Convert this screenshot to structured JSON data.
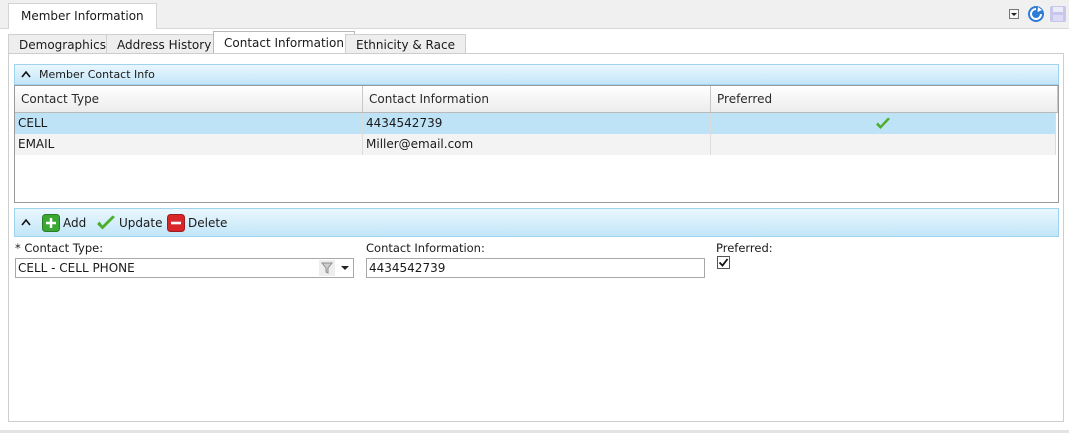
{
  "window": {
    "tab_title": "Member Information"
  },
  "tabs": [
    {
      "label": "Demographics"
    },
    {
      "label": "Address History"
    },
    {
      "label": "Contact Information"
    },
    {
      "label": "Ethnicity & Race"
    }
  ],
  "active_tab_index": 2,
  "section": {
    "title": "Member Contact Info"
  },
  "grid": {
    "columns": [
      "Contact Type",
      "Contact Information",
      "Preferred"
    ],
    "rows": [
      {
        "type": "CELL",
        "info": "4434542739",
        "preferred": true,
        "selected": true
      },
      {
        "type": "EMAIL",
        "info": "Miller@email.com",
        "preferred": false,
        "selected": false
      }
    ]
  },
  "toolbar": {
    "add_label": "Add",
    "update_label": "Update",
    "delete_label": "Delete"
  },
  "form": {
    "contact_type_label": "* Contact Type:",
    "contact_type_value": "CELL - CELL PHONE",
    "contact_info_label": "Contact Information:",
    "contact_info_value": "4434542739",
    "preferred_label": "Preferred:",
    "preferred_checked": true
  },
  "icons": {
    "menu": "dropdown-menu-icon",
    "refresh": "refresh-icon",
    "save": "save-icon",
    "filter": "filter-icon",
    "combo_drop": "chevron-down-icon"
  },
  "colors": {
    "selected_row": "#bfe3f6",
    "section_header": "#c2e6f9",
    "check_green": "#4caf2a",
    "add_green": "#3aa832",
    "delete_red": "#d9262a",
    "refresh_blue": "#2e7cd6"
  }
}
